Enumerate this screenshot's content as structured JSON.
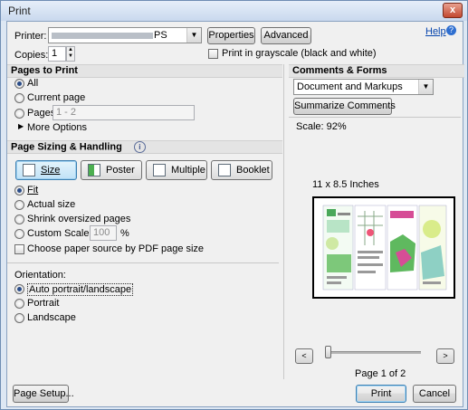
{
  "window": {
    "title": "Print",
    "close_label": "x"
  },
  "top": {
    "printer_label": "Printer:",
    "printer_value": "PS",
    "properties_label": "Properties",
    "advanced_label": "Advanced",
    "help_label": "Help",
    "copies_label": "Copies:",
    "copies_value": "1",
    "grayscale_label": "Print in grayscale (black and white)"
  },
  "pages_to_print": {
    "title": "Pages to Print",
    "all_label": "All",
    "current_label": "Current page",
    "pages_label": "Pages",
    "pages_value": "1 - 2",
    "more_options_label": "More Options"
  },
  "comments_forms": {
    "title": "Comments & Forms",
    "select_value": "Document and Markups",
    "summarize_label": "Summarize Comments",
    "scale_text": "Scale: 92%"
  },
  "sizing": {
    "title": "Page Sizing & Handling",
    "buttons": {
      "size": "Size",
      "poster": "Poster",
      "multiple": "Multiple",
      "booklet": "Booklet"
    },
    "fit_label": "Fit",
    "actual_label": "Actual size",
    "shrink_label": "Shrink oversized pages",
    "custom_label": "Custom Scale:",
    "custom_value": "100",
    "percent": "%",
    "paper_source_label": "Choose paper source by PDF page size"
  },
  "orientation": {
    "title": "Orientation:",
    "auto_label": "Auto portrait/landscape",
    "portrait_label": "Portrait",
    "landscape_label": "Landscape"
  },
  "preview": {
    "paper_size": "11 x 8.5 Inches",
    "prev_label": "<",
    "next_label": ">",
    "page_indicator": "Page 1 of 2",
    "slider_fraction": 0.0
  },
  "bottom": {
    "page_setup_label": "Page Setup...",
    "print_label": "Print",
    "cancel_label": "Cancel"
  }
}
